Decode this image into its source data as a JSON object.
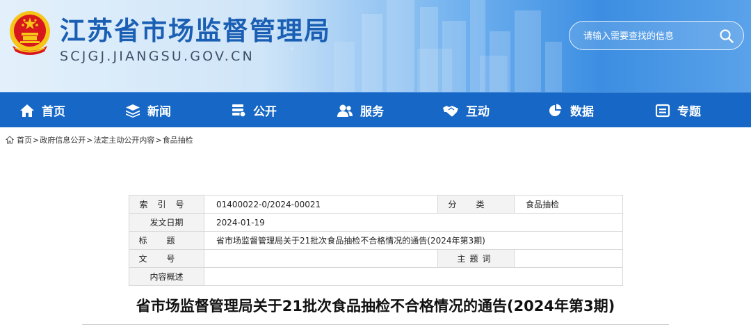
{
  "header": {
    "site_title": "江苏省市场监督管理局",
    "site_domain": "SCJGJ.JIANGSU.GOV.CN",
    "search_placeholder": "请输入需要查找的信息",
    "emblem_icon": "national-emblem-icon",
    "search_icon": "search-icon"
  },
  "nav": {
    "items": [
      {
        "label": "首页",
        "icon": "home-icon"
      },
      {
        "label": "新闻",
        "icon": "layers-icon"
      },
      {
        "label": "公开",
        "icon": "stack-icon"
      },
      {
        "label": "服务",
        "icon": "users-icon"
      },
      {
        "label": "互动",
        "icon": "handshake-icon"
      },
      {
        "label": "数据",
        "icon": "pie-chart-icon"
      },
      {
        "label": "专题",
        "icon": "topic-icon"
      }
    ]
  },
  "breadcrumb": {
    "home": "首页",
    "items": [
      "政府信息公开",
      "法定主动公开内容",
      "食品抽检"
    ],
    "separator": ">"
  },
  "info_table": {
    "index_label": "索引号",
    "index_value": "01400022-0/2024-00021",
    "category_label": "分类",
    "category_value": "食品抽检",
    "date_label": "发文日期",
    "date_value": "2024-01-19",
    "title_label": "标题",
    "title_value": "省市场监督管理局关于21批次食品抽检不合格情况的通告(2024年第3期)",
    "docno_label": "文号",
    "docno_value": "",
    "keyword_label": "主题词",
    "keyword_value": "",
    "summary_label": "内容概述",
    "summary_value": ""
  },
  "article": {
    "title": "省市场监督管理局关于21批次食品抽检不合格情况的通告(2024年第3期)"
  },
  "colors": {
    "nav_bg": "#1667c6",
    "title_blue": "#1a5fb4",
    "emblem_red": "#d8161d",
    "emblem_gold": "#f5c518"
  }
}
